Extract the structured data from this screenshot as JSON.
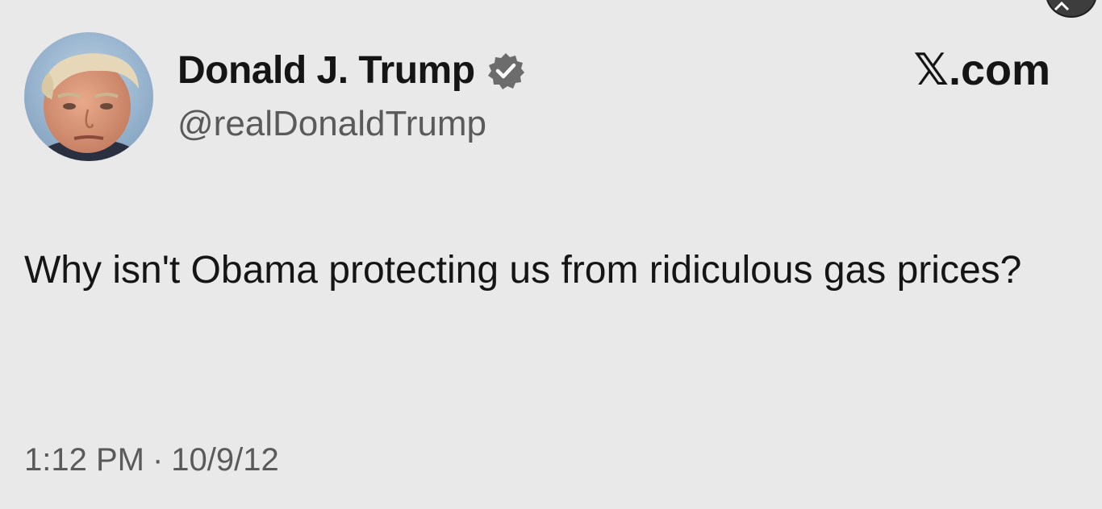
{
  "author": {
    "display_name": "Donald J. Trump",
    "handle": "@realDonaldTrump",
    "verified": true
  },
  "site_label": "𝕏.com",
  "tweet": {
    "text": "Why isn't Obama protecting us from ridiculous gas prices?",
    "time": "1:12 PM",
    "separator": "·",
    "date": "10/9/12"
  },
  "colors": {
    "background": "#e9e9e9",
    "text": "#151515",
    "secondary_text": "#5a5a5a",
    "verified_badge": "#6c6c6c"
  },
  "icons": {
    "verified": "verified-badge-icon",
    "avatar": "profile-photo",
    "corner": "share-icon"
  }
}
